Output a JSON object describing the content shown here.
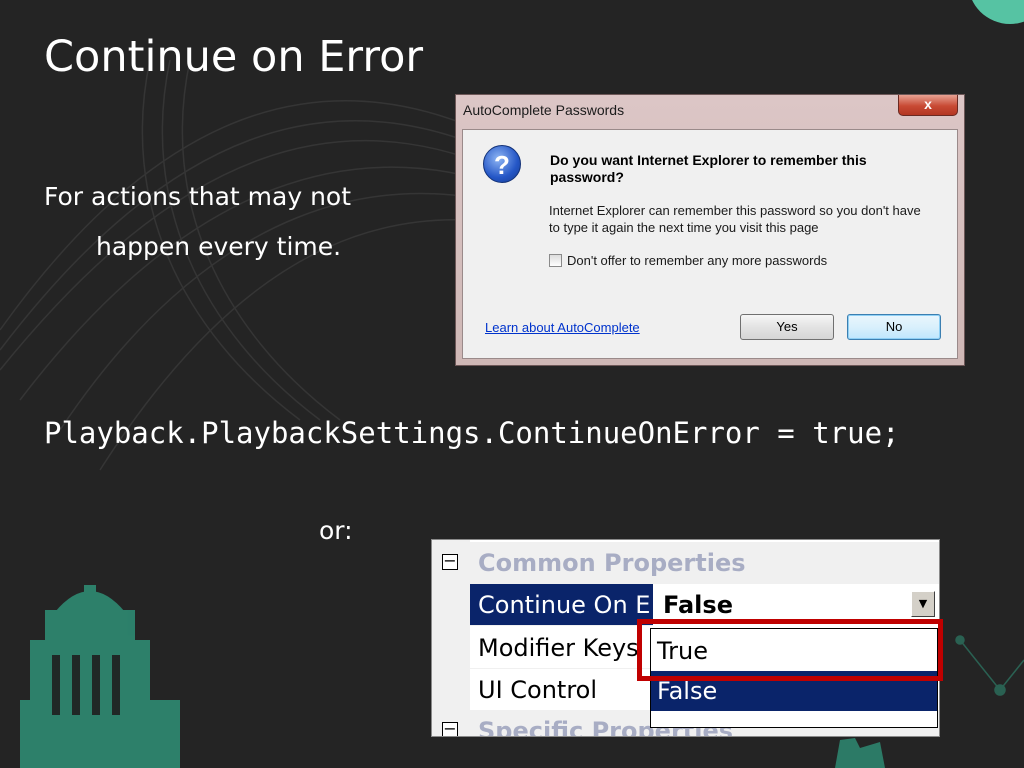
{
  "slide": {
    "title": "Continue on Error",
    "bullet_line1": "For actions that may not",
    "bullet_line2": "happen every time.",
    "code": "Playback.PlaybackSettings.ContinueOnError = true;",
    "or_text": "or:"
  },
  "dialog": {
    "title": "AutoComplete Passwords",
    "close_glyph": "x",
    "question": "Do you want Internet Explorer to remember this password?",
    "info": "Internet Explorer can remember this password so you don't have to type it again the next time you visit this page",
    "checkbox_label": "Don't offer to remember any more passwords",
    "checkbox_checked": false,
    "link": "Learn about AutoComplete",
    "yes_label": "Yes",
    "no_label": "No",
    "icon": "question-icon"
  },
  "properties": {
    "category1": "Common Properties",
    "rows": [
      {
        "name": "Continue On E",
        "value": "False"
      },
      {
        "name": "Modifier Keys",
        "value": ""
      },
      {
        "name": "UI Control",
        "value": ""
      }
    ],
    "category2": "Specific Properties",
    "dropdown_options": [
      "True",
      "False"
    ],
    "selected_option": "False"
  },
  "colors": {
    "highlight": "#c00000",
    "selection": "#0a246a",
    "accent_teal": "#2e8a72"
  }
}
